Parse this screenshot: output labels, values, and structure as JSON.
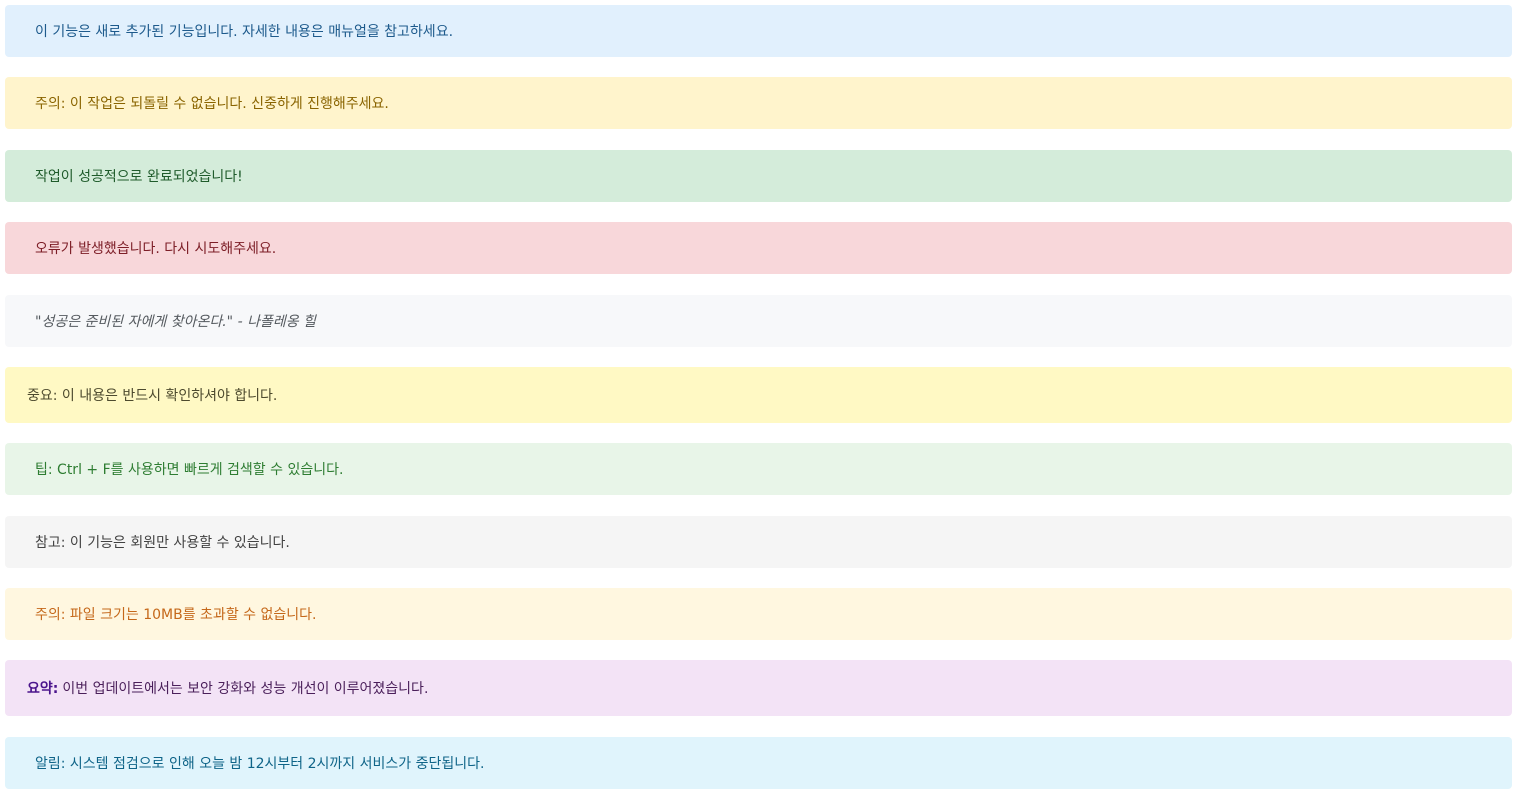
{
  "alerts": {
    "info": {
      "text": "이 기능은 새로 추가된 기능입니다. 자세한 내용은 매뉴얼을 참고하세요."
    },
    "warning": {
      "text": "주의: 이 작업은 되돌릴 수 없습니다. 신중하게 진행해주세요."
    },
    "success": {
      "text": "작업이 성공적으로 완료되었습니다!"
    },
    "danger": {
      "text": "오류가 발생했습니다. 다시 시도해주세요."
    },
    "quote": {
      "text": "\"성공은 준비된 자에게 찾아온다.\" - 나폴레옹 힐"
    },
    "important": {
      "text": "중요: 이 내용은 반드시 확인하셔야 합니다."
    },
    "tip": {
      "text": "팁: Ctrl + F를 사용하면 빠르게 검색할 수 있습니다."
    },
    "note": {
      "text": "참고: 이 기능은 회원만 사용할 수 있습니다."
    },
    "caution": {
      "text": "주의: 파일 크기는 10MB를 초과할 수 없습니다."
    },
    "summary": {
      "label": "요약:",
      "text": "이번 업데이트에서는 보안 강화와 성능 개선이 이루어졌습니다."
    },
    "notice": {
      "text": "알림: 시스템 점검으로 인해 오늘 밤 12시부터 2시까지 서비스가 중단됩니다."
    }
  },
  "colors": {
    "info_accent": "#2196f3",
    "warning_accent": "#f5c20f",
    "success_accent": "#28a745",
    "danger_accent": "#dc3545",
    "quote_accent": "#6c757d",
    "important_border": "#f0c14b",
    "tip_accent": "#4caf50",
    "note_accent": "#9e9e9e",
    "caution_accent": "#ff9800",
    "summary_border": "#8e24aa",
    "notice_accent": "#03a9f4"
  }
}
